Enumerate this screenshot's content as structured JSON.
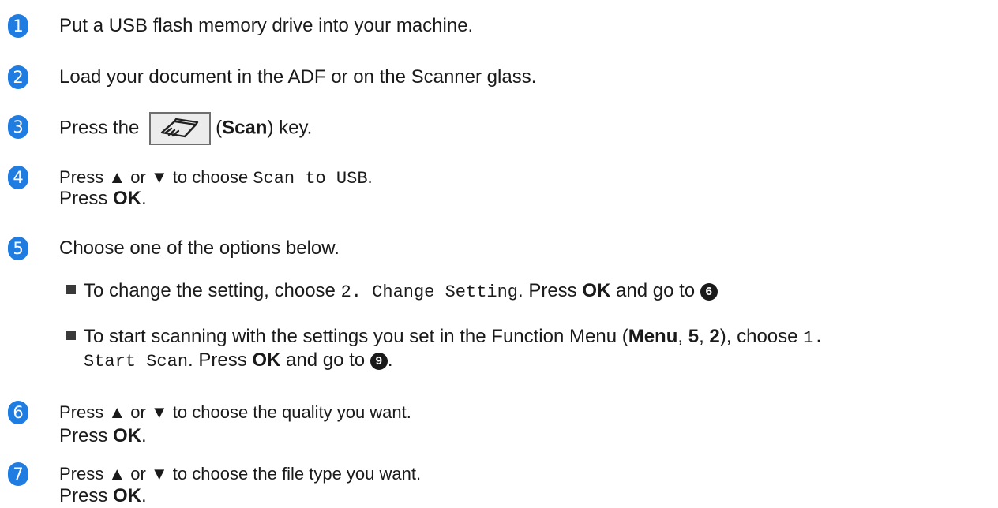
{
  "steps": [
    {
      "num": "1",
      "parts": {
        "a": "Put a USB flash memory drive into your machine."
      }
    },
    {
      "num": "2",
      "parts": {
        "a": "Load your document in the ADF or on the Scanner glass."
      }
    },
    {
      "num": "3",
      "parts": {
        "a": "Press the",
        "key_paren_open": "(",
        "key_name": "Scan",
        "key_paren_close": ") key."
      }
    },
    {
      "num": "4",
      "parts": {
        "a": "Press ▲ or ▼ to choose ",
        "code": "Scan to USB",
        "end": ".",
        "line2_a": "Press ",
        "line2_b": "OK",
        "line2_c": "."
      }
    },
    {
      "num": "5",
      "parts": {
        "a": "Choose one of the options below."
      }
    },
    {
      "num": "6",
      "parts": {
        "a": "Press ▲ or ▼ to choose the quality you want.",
        "line2_a": "Press ",
        "line2_b": "OK",
        "line2_c": "."
      }
    },
    {
      "num": "7",
      "parts": {
        "a": "Press ▲ or ▼ to choose the file type you want.",
        "line2_a": "Press ",
        "line2_b": "OK",
        "line2_c": "."
      }
    }
  ],
  "options": [
    {
      "a": "To change the setting, choose ",
      "code": "2. Change Setting",
      "b": ". Press ",
      "ok": "OK",
      "c": " and go to ",
      "ref": "6"
    },
    {
      "a": "To start scanning with the settings you set in the Function Menu (",
      "menu": "Menu",
      "comma1": ", ",
      "five": "5",
      "comma2": ", ",
      "two": "2",
      "b": "),  choose ",
      "code1": "1.",
      "code2": "Start Scan",
      "c": ". Press ",
      "ok": "OK",
      "d": " and go to ",
      "ref": "9",
      "end": "."
    }
  ],
  "icons": {
    "scan_key": "scanner-icon"
  },
  "colors": {
    "badge": "#1f7ce0",
    "text": "#1a1a1a"
  }
}
